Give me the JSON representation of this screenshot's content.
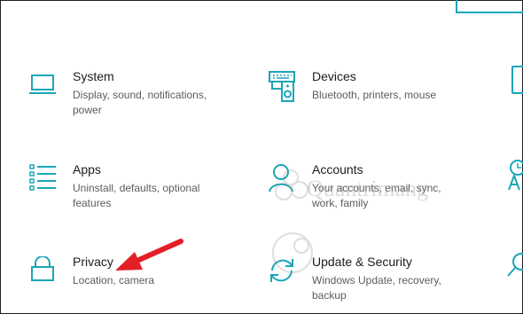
{
  "tiles": [
    {
      "title": "System",
      "desc": "Display, sound, notifications, power",
      "icon": "laptop-icon"
    },
    {
      "title": "Devices",
      "desc": "Bluetooth, printers, mouse",
      "icon": "keyboard-speaker-icon"
    },
    {
      "title": "Apps",
      "desc": "Uninstall, defaults, optional features",
      "icon": "apps-list-icon"
    },
    {
      "title": "Accounts",
      "desc": "Your accounts, email, sync, work, family",
      "icon": "person-icon"
    },
    {
      "title": "Privacy",
      "desc": "Location, camera",
      "icon": "lock-icon"
    },
    {
      "title": "Update & Security",
      "desc": "Windows Update, recovery, backup",
      "icon": "refresh-icon"
    }
  ],
  "watermark": {
    "text": "Quantrimang"
  },
  "colors": {
    "accent": "#1aa6b7",
    "arrow": "#e41e26",
    "title": "#1b1b1b",
    "desc": "#5c5c5c"
  }
}
